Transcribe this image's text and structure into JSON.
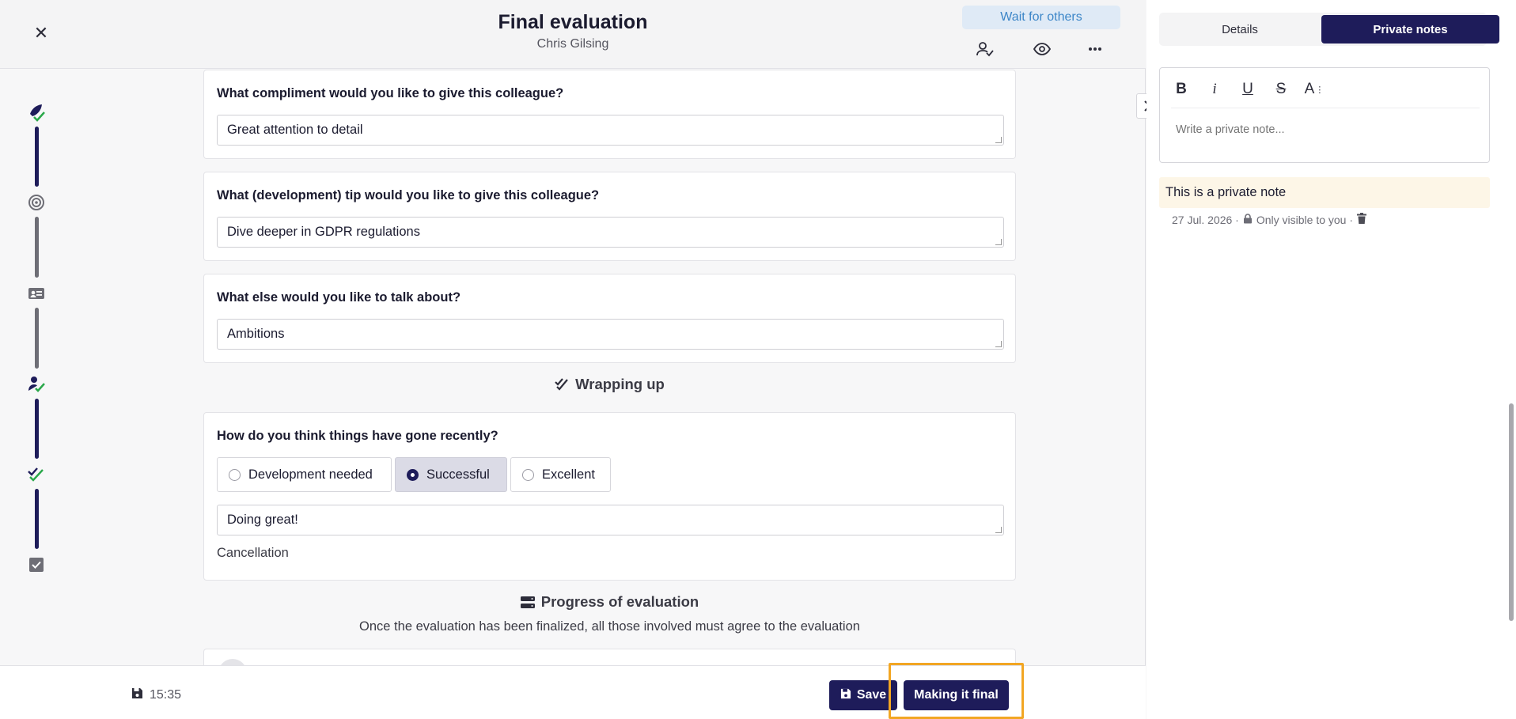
{
  "header": {
    "close_icon": "close-icon",
    "title": "Final evaluation",
    "subtitle": "Chris Gilsing",
    "wait_button": "Wait for others",
    "icons": [
      "person-check-icon",
      "eye-icon",
      "more-icon"
    ]
  },
  "progress_rail": {
    "steps": [
      "rocket-check-icon",
      "target-icon",
      "id-card-icon",
      "person-check-icon",
      "double-check-icon",
      "checkbox-icon"
    ]
  },
  "questions": [
    {
      "label": "What compliment would you like to give this colleague?",
      "answer": "Great attention to detail"
    },
    {
      "label": "What (development) tip would you like to give this colleague?",
      "answer": "Dive deeper in GDPR regulations"
    },
    {
      "label": "What else would you like to talk about?",
      "answer": "Ambitions"
    }
  ],
  "wrapping_up": {
    "section_title": "Wrapping up",
    "question": "How do you think things have gone recently?",
    "options": [
      "Development needed",
      "Successful",
      "Excellent"
    ],
    "selected": "Successful",
    "answer": "Doing great!",
    "extra_text": "Cancellation"
  },
  "progress_section": {
    "title": "Progress of evaluation",
    "description": "Once the evaluation has been finalized, all those involved must agree to the evaluation"
  },
  "footer": {
    "saved_time": "15:35",
    "save_button": "Save",
    "final_button": "Making it final"
  },
  "side_panel": {
    "tabs": [
      "Details",
      "Private notes"
    ],
    "active_tab": "Private notes",
    "toolbar": {
      "bold": "B",
      "italic": "i",
      "underline": "U",
      "strike": "S",
      "size": "A"
    },
    "note_placeholder": "Write a private note...",
    "note_text": "This is a private note",
    "note_date": "27 Jul. 2026 ·",
    "note_visibility": "Only visible to you ·"
  },
  "colors": {
    "primary": "#1e1c5a",
    "highlight": "#f2a623",
    "success_green": "#2aa84a",
    "note_bg": "#fdf6e7"
  }
}
